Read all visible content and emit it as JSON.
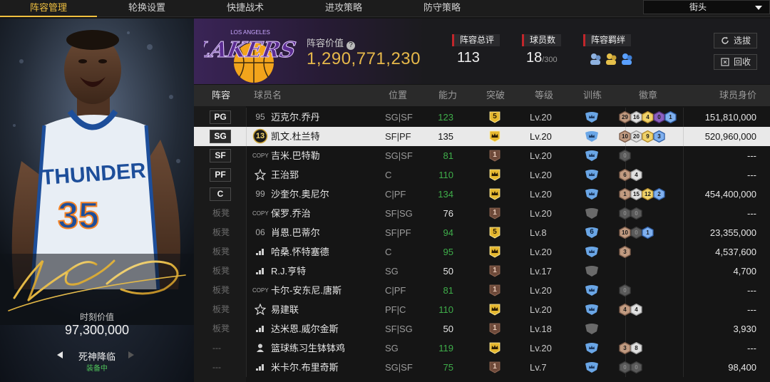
{
  "nav": {
    "tabs": [
      "阵容管理",
      "轮换设置",
      "快捷战术",
      "进攻策略",
      "防守策略"
    ],
    "active_tab": 0,
    "mode_select": "街头"
  },
  "card": {
    "jersey_team": "THUNDER",
    "jersey_number": "35",
    "moment_value_label": "时刻价值",
    "moment_value": "97,300,000",
    "skill_name": "死神降临",
    "skill_status": "装备中"
  },
  "header": {
    "team_logo_text": "LAKERS",
    "team_logo_subtext": "LOS ANGELES",
    "lineup_value_label": "阵容价值",
    "lineup_value": "1,290,771,230",
    "overall_label": "阵容总评",
    "overall_value": "113",
    "players_label": "球员数",
    "players_count": "18",
    "players_max": "/300",
    "synergy_label": "阵容羁绊",
    "select_button": "选拔",
    "recycle_button": "回收"
  },
  "table": {
    "headers": [
      "阵容",
      "球员名",
      "位置",
      "能力",
      "突破",
      "等级",
      "训练",
      "徽章",
      "球员身价"
    ],
    "rows": [
      {
        "slot": "PG",
        "starter": true,
        "rank": "95",
        "rank_type": "number",
        "name": "迈克尔.乔丹",
        "pos": "SG|SF",
        "ability": "123",
        "ability_color": "green",
        "breakthrough": "5",
        "break_type": "gold-num",
        "level": "Lv.20",
        "train": "blue",
        "badges": [
          {
            "n": "29",
            "c": "bronze"
          },
          {
            "n": "16",
            "c": "silver"
          },
          {
            "n": "4",
            "c": "gold"
          },
          {
            "n": "0",
            "c": "purple"
          },
          {
            "n": "1",
            "c": "blue"
          }
        ],
        "value": "151,810,000",
        "selected": false
      },
      {
        "slot": "SG",
        "starter": true,
        "rank": "13",
        "rank_type": "medal",
        "name": "凯文.杜兰特",
        "pos": "SF|PF",
        "ability": "135",
        "ability_color": "white",
        "breakthrough": "",
        "break_type": "gold-crown",
        "level": "Lv.20",
        "train": "blue",
        "badges": [
          {
            "n": "10",
            "c": "bronze"
          },
          {
            "n": "20",
            "c": "silver"
          },
          {
            "n": "9",
            "c": "gold"
          },
          {
            "n": "3",
            "c": "blue"
          }
        ],
        "value": "520,960,000",
        "selected": true
      },
      {
        "slot": "SF",
        "starter": true,
        "rank": "COPY",
        "rank_type": "copy",
        "name": "吉米.巴特勒",
        "pos": "SG|SF",
        "ability": "81",
        "ability_color": "green",
        "breakthrough": "1",
        "break_type": "bronze-num",
        "level": "Lv.20",
        "train": "blue",
        "badges": [
          {
            "n": "0",
            "c": "grey"
          }
        ],
        "value": "---",
        "selected": false
      },
      {
        "slot": "PF",
        "starter": true,
        "rank": "",
        "rank_type": "star",
        "name": "王治郅",
        "pos": "C",
        "ability": "110",
        "ability_color": "green",
        "breakthrough": "",
        "break_type": "gold-crown",
        "level": "Lv.20",
        "train": "blue",
        "badges": [
          {
            "n": "6",
            "c": "bronze"
          },
          {
            "n": "4",
            "c": "silver"
          }
        ],
        "value": "---",
        "selected": false
      },
      {
        "slot": "C",
        "starter": true,
        "rank": "99",
        "rank_type": "number",
        "name": "沙奎尔.奥尼尔",
        "pos": "C|PF",
        "ability": "134",
        "ability_color": "green",
        "breakthrough": "",
        "break_type": "gold-crown",
        "level": "Lv.20",
        "train": "blue",
        "badges": [
          {
            "n": "1",
            "c": "bronze"
          },
          {
            "n": "15",
            "c": "silver"
          },
          {
            "n": "12",
            "c": "gold"
          },
          {
            "n": "2",
            "c": "blue"
          }
        ],
        "value": "454,400,000",
        "selected": false
      },
      {
        "slot": "板凳",
        "starter": false,
        "rank": "COPY",
        "rank_type": "copy",
        "name": "保罗.乔治",
        "pos": "SF|SG",
        "ability": "76",
        "ability_color": "white",
        "breakthrough": "1",
        "break_type": "bronze-num",
        "level": "Lv.20",
        "train": "grey",
        "badges": [
          {
            "n": "0",
            "c": "grey"
          },
          {
            "n": "0",
            "c": "grey"
          }
        ],
        "value": "---",
        "selected": false
      },
      {
        "slot": "板凳",
        "starter": false,
        "rank": "06",
        "rank_type": "number",
        "name": "肖恩.巴蒂尔",
        "pos": "SF|PF",
        "ability": "94",
        "ability_color": "green",
        "breakthrough": "5",
        "break_type": "gold-num",
        "level": "Lv.8",
        "train": "blue-num",
        "train_num": "6",
        "badges": [
          {
            "n": "10",
            "c": "bronze"
          },
          {
            "n": "0",
            "c": "grey"
          },
          {
            "n": "1",
            "c": "blue"
          }
        ],
        "value": "23,355,000",
        "selected": false
      },
      {
        "slot": "板凳",
        "starter": false,
        "rank": "",
        "rank_type": "bars",
        "name": "哈桑.怀特塞德",
        "pos": "C",
        "ability": "95",
        "ability_color": "green",
        "breakthrough": "",
        "break_type": "gold-crown",
        "level": "Lv.20",
        "train": "blue",
        "badges": [
          {
            "n": "3",
            "c": "bronze"
          }
        ],
        "value": "4,537,600",
        "selected": false
      },
      {
        "slot": "板凳",
        "starter": false,
        "rank": "",
        "rank_type": "bars",
        "name": "R.J.亨特",
        "pos": "SG",
        "ability": "50",
        "ability_color": "white",
        "breakthrough": "1",
        "break_type": "bronze-num",
        "level": "Lv.17",
        "train": "grey",
        "badges": [],
        "value": "4,700",
        "selected": false
      },
      {
        "slot": "板凳",
        "starter": false,
        "rank": "COPY",
        "rank_type": "copy",
        "name": "卡尔-安东尼.唐斯",
        "pos": "C|PF",
        "ability": "81",
        "ability_color": "green",
        "breakthrough": "1",
        "break_type": "bronze-num",
        "level": "Lv.20",
        "train": "blue",
        "badges": [
          {
            "n": "0",
            "c": "grey"
          }
        ],
        "value": "---",
        "selected": false
      },
      {
        "slot": "板凳",
        "starter": false,
        "rank": "",
        "rank_type": "star",
        "name": "易建联",
        "pos": "PF|C",
        "ability": "110",
        "ability_color": "green",
        "breakthrough": "",
        "break_type": "gold-crown",
        "level": "Lv.20",
        "train": "blue",
        "badges": [
          {
            "n": "4",
            "c": "bronze"
          },
          {
            "n": "4",
            "c": "silver"
          }
        ],
        "value": "---",
        "selected": false
      },
      {
        "slot": "板凳",
        "starter": false,
        "rank": "",
        "rank_type": "bars",
        "name": "达米恩.威尔金斯",
        "pos": "SF|SG",
        "ability": "50",
        "ability_color": "white",
        "breakthrough": "1",
        "break_type": "bronze-num",
        "level": "Lv.18",
        "train": "grey",
        "badges": [],
        "value": "3,930",
        "selected": false
      },
      {
        "slot": "---",
        "starter": false,
        "rank": "",
        "rank_type": "person",
        "name": "篮球练习生钵钵鸡",
        "pos": "SG",
        "ability": "119",
        "ability_color": "green",
        "breakthrough": "",
        "break_type": "gold-crown",
        "level": "Lv.20",
        "train": "blue",
        "badges": [
          {
            "n": "3",
            "c": "bronze"
          },
          {
            "n": "8",
            "c": "silver"
          }
        ],
        "value": "---",
        "selected": false
      },
      {
        "slot": "---",
        "starter": false,
        "rank": "",
        "rank_type": "bars",
        "name": "米卡尔.布里奇斯",
        "pos": "SG|SF",
        "ability": "75",
        "ability_color": "green",
        "breakthrough": "1",
        "break_type": "bronze-num",
        "level": "Lv.7",
        "train": "blue",
        "badges": [
          {
            "n": "0",
            "c": "grey"
          },
          {
            "n": "0",
            "c": "grey"
          }
        ],
        "value": "98,400",
        "selected": false
      }
    ]
  },
  "colors": {
    "accent": "#f0c040",
    "gold_value": "#e6b84a",
    "green_ability": "#3fae4a",
    "red_tag": "#c2262b",
    "team_purple": "#3a2456"
  }
}
